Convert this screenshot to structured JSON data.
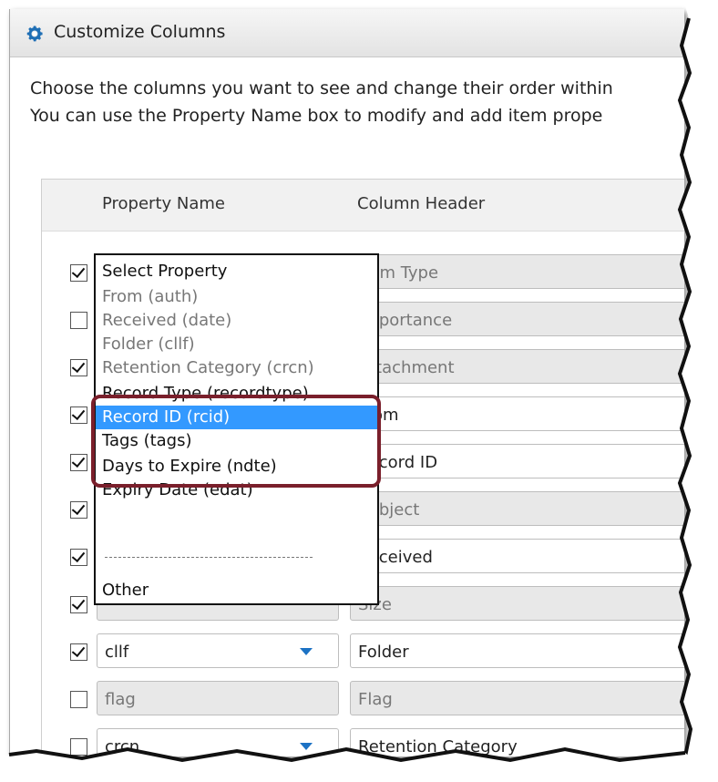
{
  "dialog": {
    "title": "Customize Columns",
    "description_line1": "Choose the columns you want to see and change their order within",
    "description_line2": "You can use the Property Name box to modify and add item prope",
    "header_property": "Property Name",
    "header_column": "Column Header"
  },
  "rows": [
    {
      "checked": true,
      "property": "",
      "prop_disabled": true,
      "column": "Item Type",
      "col_disabled": true
    },
    {
      "checked": false,
      "property": "",
      "prop_disabled": true,
      "column": "Importance",
      "col_disabled": true
    },
    {
      "checked": true,
      "property": "",
      "prop_disabled": true,
      "column": "Attachment",
      "col_disabled": true
    },
    {
      "checked": true,
      "property": "",
      "prop_disabled": false,
      "column": "From",
      "col_disabled": false
    },
    {
      "checked": true,
      "property": "",
      "prop_disabled": false,
      "column": "Record ID",
      "col_disabled": false
    },
    {
      "checked": true,
      "property": "",
      "prop_disabled": true,
      "column": "Subject",
      "col_disabled": true
    },
    {
      "checked": true,
      "property": "",
      "prop_disabled": false,
      "column": "Received",
      "col_disabled": false
    },
    {
      "checked": true,
      "property": "",
      "prop_disabled": true,
      "column": "Size",
      "col_disabled": true
    },
    {
      "checked": true,
      "property": "cllf",
      "prop_disabled": false,
      "column": "Folder",
      "col_disabled": false,
      "dropdown": true
    },
    {
      "checked": false,
      "property": "flag",
      "prop_disabled": true,
      "column": "Flag",
      "col_disabled": true
    },
    {
      "checked": false,
      "property": "crcn",
      "prop_disabled": false,
      "column": "Retention Category",
      "col_disabled": false,
      "dropdown": true
    }
  ],
  "dropdown": {
    "options": [
      {
        "label": "Select Property",
        "state": "normal"
      },
      {
        "label": "From (auth)",
        "state": "dim"
      },
      {
        "label": "Received (date)",
        "state": "dim"
      },
      {
        "label": "Folder (cllf)",
        "state": "dim"
      },
      {
        "label": "Retention Category (crcn)",
        "state": "dim"
      },
      {
        "label": "Record Type (recordtype)",
        "state": "normal"
      },
      {
        "label": "Record ID (rcid)",
        "state": "selected"
      },
      {
        "label": "Tags (tags)",
        "state": "normal"
      },
      {
        "label": "Days to Expire (ndte)",
        "state": "normal"
      },
      {
        "label": "Expiry Date (edat)",
        "state": "normal"
      },
      {
        "label": "Other",
        "state": "normal"
      }
    ]
  },
  "colors": {
    "selection": "#3399ff",
    "highlight_border": "#7a1f2b",
    "caret": "#1c72c4"
  },
  "icons": {
    "title": "gear-icon"
  }
}
